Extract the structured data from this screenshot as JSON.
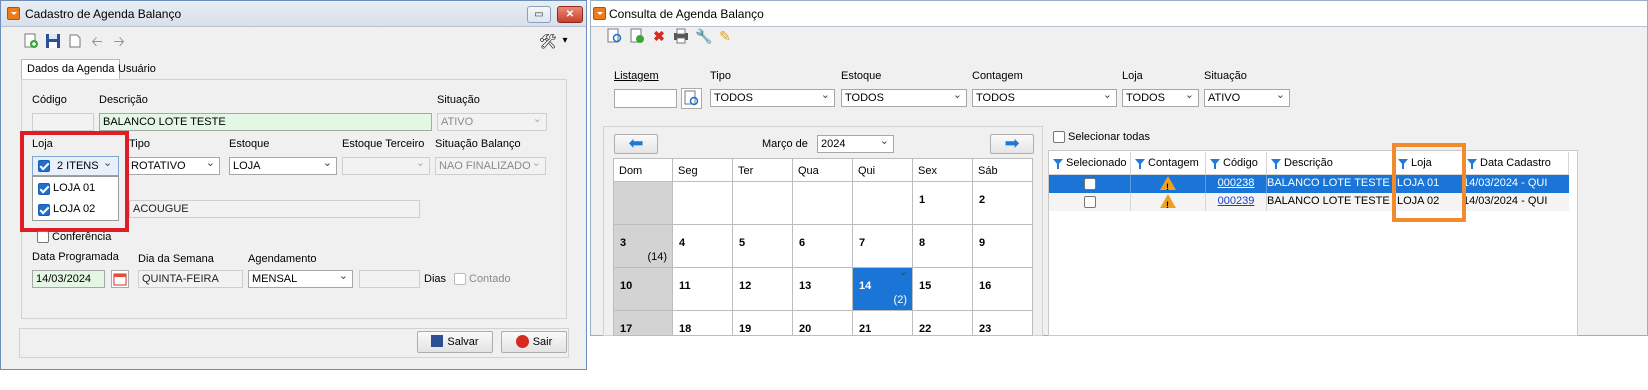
{
  "left_window": {
    "title": "Cadastro de Agenda Balanço",
    "title_buttons": {
      "restore": "▭",
      "close": "✕"
    },
    "toolbar": {
      "icons": [
        "new-icon",
        "save-icon",
        "copy-icon",
        "back-arrow-icon",
        "forward-arrow-icon"
      ],
      "tools": "🛠",
      "tools_caret": "▾"
    },
    "tabs": [
      "Dados da Agenda",
      "Usuário"
    ],
    "fields": {
      "codigo_label": "Código",
      "descricao_label": "Descrição",
      "descricao_value": "BALANCO LOTE TESTE",
      "situacao_label": "Situação",
      "situacao_value": "ATIVO",
      "loja_label": "Loja",
      "loja_value": "2 ITENS",
      "tipo_label": "Tipo",
      "tipo_value": "ROTATIVO",
      "estoque_label": "Estoque",
      "estoque_value": "LOJA",
      "estoque_terceiro_label": "Estoque Terceiro",
      "situacao_balanco_label": "Situação Balanço",
      "situacao_balanco_value": "NAO FINALIZADO",
      "secao_value": "ACOUGUE",
      "conferencia_label": "Conferência",
      "data_programada_label": "Data Programada",
      "data_programada_value": "14/03/2024",
      "dia_semana_label": "Dia da Semana",
      "dia_semana_value": "QUINTA-FEIRA",
      "agendamento_label": "Agendamento",
      "agendamento_value": "MENSAL",
      "dias_label": "Dias",
      "contado_label": "Contado"
    },
    "loja_dropdown": [
      {
        "label": "LOJA 01",
        "checked": true
      },
      {
        "label": "LOJA 02",
        "checked": true
      }
    ],
    "buttons": {
      "salvar": "Salvar",
      "sair": "Sair"
    }
  },
  "right_window": {
    "title": "Consulta de Agenda Balanço",
    "toolbar": {
      "icons": [
        "search-doc-icon",
        "new-doc-icon",
        "delete-x-icon",
        "print-icon",
        "wrench-icon",
        "edit-pencil-icon"
      ]
    },
    "filters": {
      "listagem_label": "Listagem",
      "tipo_label": "Tipo",
      "tipo_value": "TODOS",
      "estoque_label": "Estoque",
      "estoque_value": "TODOS",
      "contagem_label": "Contagem",
      "contagem_value": "TODOS",
      "loja_label": "Loja",
      "loja_value": "TODOS",
      "situacao_label": "Situação",
      "situacao_value": "ATIVO"
    },
    "calendar": {
      "month_label": "Março de",
      "year": "2024",
      "prev": "⬅",
      "next": "➡",
      "weekdays": [
        "Dom",
        "Seg",
        "Ter",
        "Qua",
        "Qui",
        "Sex",
        "Sáb"
      ],
      "weeks": [
        [
          {
            "d": "",
            "gray": true
          },
          {
            "d": ""
          },
          {
            "d": ""
          },
          {
            "d": ""
          },
          {
            "d": ""
          },
          {
            "d": "1"
          },
          {
            "d": "2"
          }
        ],
        [
          {
            "d": "3",
            "gray": true,
            "count": "(14)"
          },
          {
            "d": "4"
          },
          {
            "d": "5"
          },
          {
            "d": "6"
          },
          {
            "d": "7"
          },
          {
            "d": "8"
          },
          {
            "d": "9"
          }
        ],
        [
          {
            "d": "10",
            "gray": true
          },
          {
            "d": "11"
          },
          {
            "d": "12"
          },
          {
            "d": "13"
          },
          {
            "d": "14",
            "selected": true,
            "count": "(2)"
          },
          {
            "d": "15"
          },
          {
            "d": "16"
          }
        ],
        [
          {
            "d": "17",
            "gray": true
          },
          {
            "d": "18"
          },
          {
            "d": "19"
          },
          {
            "d": "20"
          },
          {
            "d": "21"
          },
          {
            "d": "22"
          },
          {
            "d": "23"
          }
        ]
      ]
    },
    "select_all_label": "Selecionar todas",
    "grid": {
      "columns": [
        "Selecionado",
        "Contagem",
        "Código",
        "Descrição",
        "Loja",
        "Data Cadastro"
      ],
      "rows": [
        {
          "codigo": "000238",
          "descricao": "BALANCO LOTE TESTE",
          "loja": "LOJA 01",
          "data": "14/03/2024 - QUI",
          "selected_row": true
        },
        {
          "codigo": "000239",
          "descricao": "BALANCO LOTE TESTE",
          "loja": "LOJA 02",
          "data": "14/03/2024 - QUI",
          "selected_row": false
        }
      ]
    }
  },
  "colors": {
    "highlight_red": "#e01c24",
    "highlight_orange": "#f28a2e",
    "selection_blue": "#1a75d6"
  }
}
